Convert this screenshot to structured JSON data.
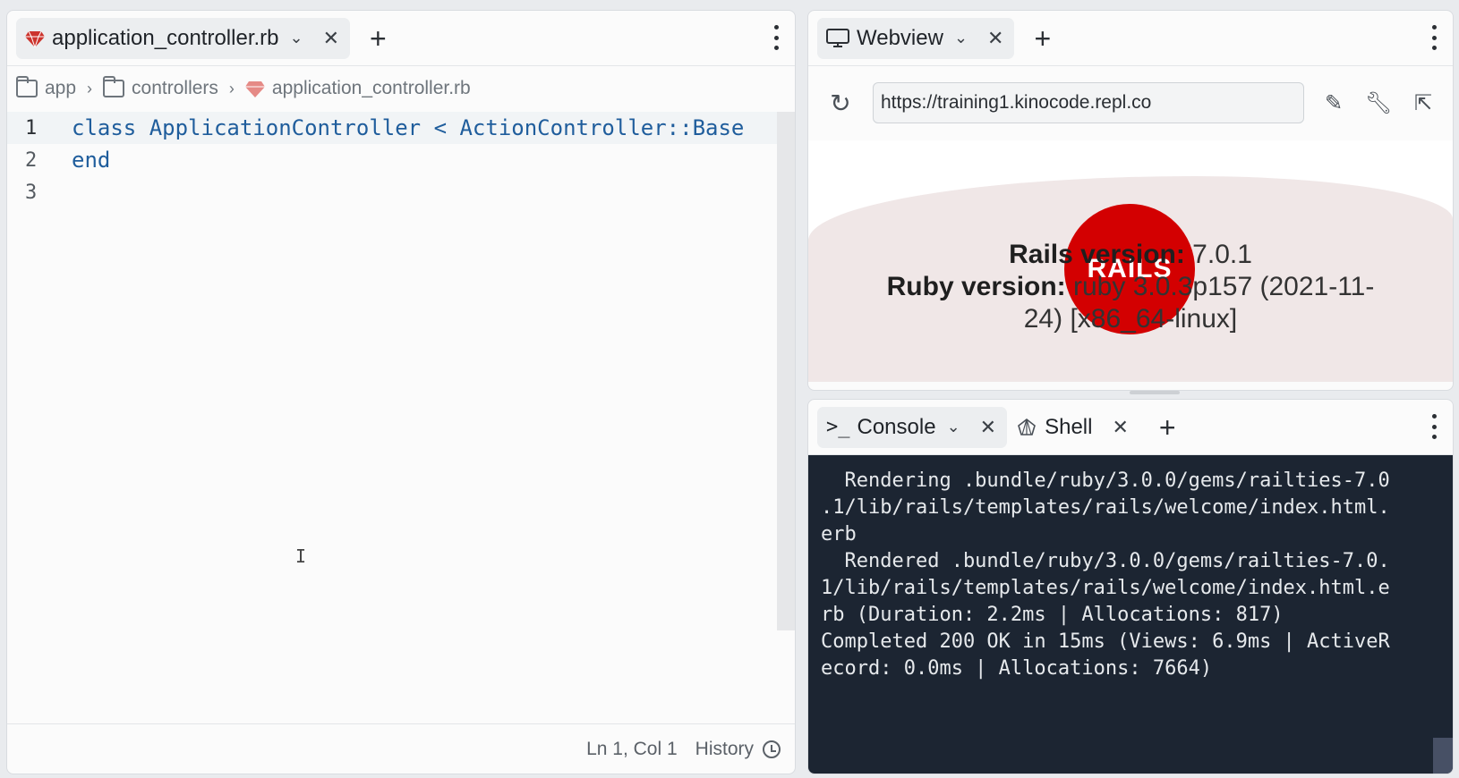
{
  "editor": {
    "tab_label": "application_controller.rb",
    "breadcrumb": [
      "app",
      "controllers",
      "application_controller.rb"
    ],
    "lines": [
      {
        "num": "1",
        "text": "class ApplicationController < ActionController::Base"
      },
      {
        "num": "2",
        "text": "end"
      },
      {
        "num": "3",
        "text": ""
      }
    ],
    "status_position": "Ln 1, Col 1",
    "history_label": "History"
  },
  "webview": {
    "tab_label": "Webview",
    "url": "https://training1.kinocode.repl.co",
    "rails_label": "Rails version:",
    "rails_value": " 7.0.1",
    "ruby_label": "Ruby version:",
    "ruby_value": " ruby 3.0.3p157 (2021-11-",
    "ruby_value_2": "24) [x86_64-linux]",
    "logo_text": "RAILS"
  },
  "console": {
    "tab_console": "Console",
    "tab_shell": "Shell",
    "output": "  Rendering .bundle/ruby/3.0.0/gems/railties-7.0\n.1/lib/rails/templates/rails/welcome/index.html.\nerb\n  Rendered .bundle/ruby/3.0.0/gems/railties-7.0.\n1/lib/rails/templates/rails/welcome/index.html.e\nrb (Duration: 2.2ms | Allocations: 817)\nCompleted 200 OK in 15ms (Views: 6.9ms | ActiveR\necord: 0.0ms | Allocations: 7664)"
  },
  "icons": {
    "close": "×",
    "plus": "+",
    "chevron": "⌄"
  }
}
